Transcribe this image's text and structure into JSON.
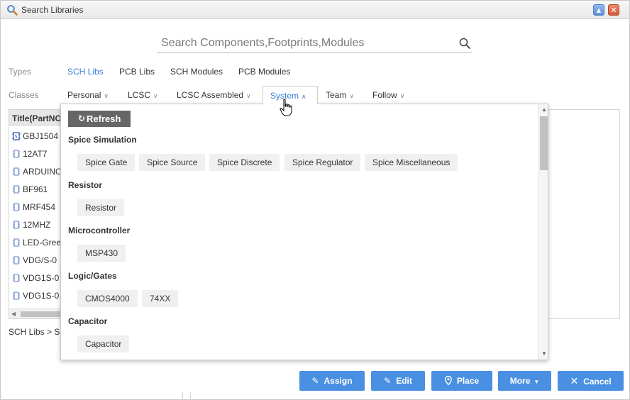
{
  "window": {
    "title": "Search Libraries",
    "minimize_icon": "minimize-icon",
    "close_icon": "close-icon"
  },
  "search": {
    "placeholder": "Search Components,Footprints,Modules",
    "value": "",
    "icon": "search-icon"
  },
  "types": {
    "label": "Types",
    "tabs": [
      {
        "label": "SCH Libs",
        "active": true
      },
      {
        "label": "PCB Libs",
        "active": false
      },
      {
        "label": "SCH Modules",
        "active": false
      },
      {
        "label": "PCB Modules",
        "active": false
      }
    ]
  },
  "classes": {
    "label": "Classes",
    "tabs": [
      {
        "label": "Personal",
        "active": false
      },
      {
        "label": "LCSC",
        "active": false
      },
      {
        "label": "LCSC Assembled",
        "active": false
      },
      {
        "label": "System",
        "active": true
      },
      {
        "label": "Team",
        "active": false
      },
      {
        "label": "Follow",
        "active": false
      }
    ]
  },
  "table": {
    "header": "Title(PartNO",
    "rows": [
      {
        "title": "GBJ1504",
        "icon": "schematic-symbol-icon"
      },
      {
        "title": "12AT7",
        "icon": "chip-icon"
      },
      {
        "title": "ARDUINO",
        "icon": "chip-icon"
      },
      {
        "title": "BF961",
        "icon": "chip-icon"
      },
      {
        "title": "MRF454",
        "icon": "chip-icon"
      },
      {
        "title": "12MHZ",
        "icon": "chip-icon"
      },
      {
        "title": "LED-Gree",
        "icon": "chip-icon"
      },
      {
        "title": "VDG/S-0",
        "icon": "chip-icon"
      },
      {
        "title": "VDG1S-0",
        "icon": "chip-icon"
      },
      {
        "title": "VDG1S-0",
        "icon": "chip-icon"
      }
    ]
  },
  "breadcrumb": "SCH Libs > S",
  "dropdown": {
    "refresh_label": "Refresh",
    "refresh_icon": "refresh-icon",
    "groups": [
      {
        "title": "Spice Simulation",
        "items": [
          "Spice Gate",
          "Spice Source",
          "Spice Discrete",
          "Spice Regulator",
          "Spice Miscellaneous"
        ]
      },
      {
        "title": "Resistor",
        "items": [
          "Resistor"
        ]
      },
      {
        "title": "Microcontroller",
        "items": [
          "MSP430"
        ]
      },
      {
        "title": "Logic/Gates",
        "items": [
          "CMOS4000",
          "74XX"
        ]
      },
      {
        "title": "Capacitor",
        "items": [
          "Capacitor"
        ]
      }
    ]
  },
  "buttons": {
    "assign": "Assign",
    "edit": "Edit",
    "place": "Place",
    "more": "More",
    "cancel": "Cancel"
  },
  "colors": {
    "accent": "#4a90e2",
    "active_tab": "#3a7fd8",
    "refresh_bg": "#666666",
    "close_button": "#d25a37",
    "minimize_button": "#5b8fd6"
  }
}
